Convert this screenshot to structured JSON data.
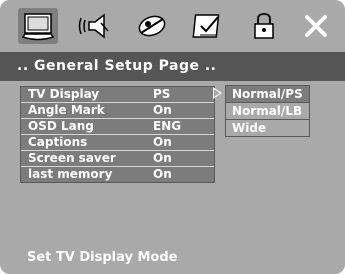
{
  "tabs": [
    {
      "icon": "monitor-icon",
      "selected": true
    },
    {
      "icon": "speaker-icon",
      "selected": false
    },
    {
      "icon": "dolby-icon",
      "selected": false
    },
    {
      "icon": "checklist-icon",
      "selected": false
    },
    {
      "icon": "lock-icon",
      "selected": false
    },
    {
      "icon": "close-icon",
      "selected": false
    }
  ],
  "page_title": ".. General Setup Page ..",
  "settings": [
    {
      "label": "TV Display",
      "value": "PS"
    },
    {
      "label": "Angle Mark",
      "value": "On"
    },
    {
      "label": "OSD Lang",
      "value": "ENG"
    },
    {
      "label": "Captions",
      "value": "On"
    },
    {
      "label": "Screen saver",
      "value": "On"
    },
    {
      "label": "last memory",
      "value": "On"
    }
  ],
  "options": [
    "Normal/PS",
    "Normal/LB",
    "Wide"
  ],
  "status_text": "Set TV Display Mode",
  "colors": {
    "background": "#a9a9a9",
    "title_bar": "#555555",
    "highlight": "#7c7c7c",
    "text": "#ffffff"
  }
}
